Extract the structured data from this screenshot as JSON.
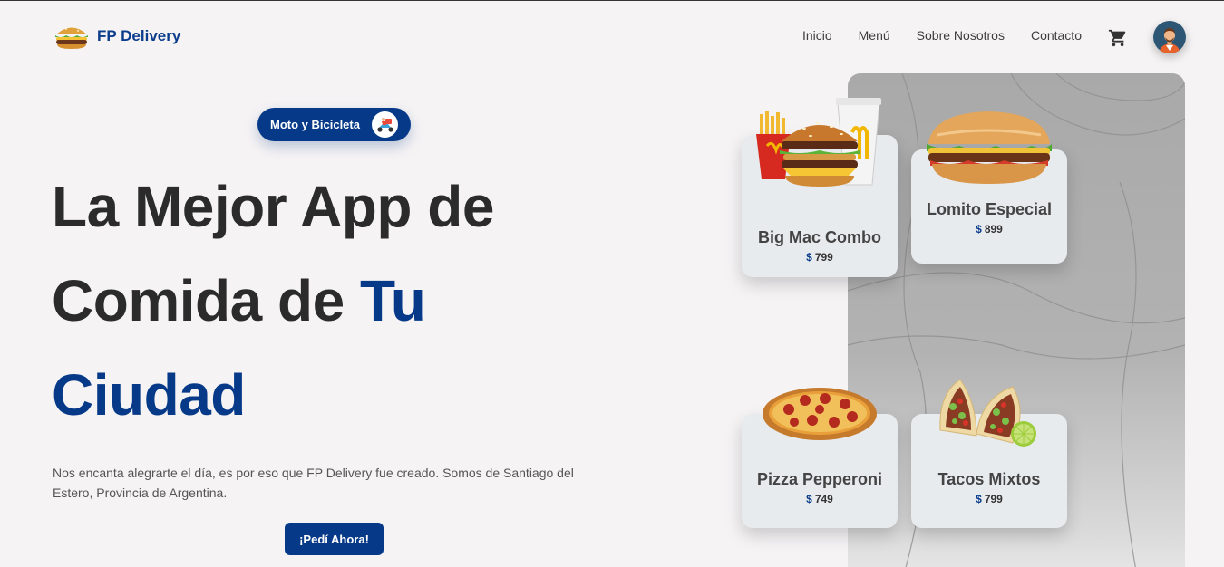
{
  "brand": {
    "name": "FP Delivery",
    "logo_icon": "burger-icon"
  },
  "nav": {
    "items": [
      {
        "label": "Inicio"
      },
      {
        "label": "Menú"
      },
      {
        "label": "Sobre Nosotros"
      },
      {
        "label": "Contacto"
      }
    ],
    "cart_icon": "cart-icon",
    "avatar_icon": "user-avatar"
  },
  "hero": {
    "pill_label": "Moto y Bicicleta",
    "pill_icon": "delivery-scooter-icon",
    "title_part1": "La Mejor App de Comida de ",
    "title_accent1": "Tu",
    "title_accent2": "Ciudad",
    "description": "Nos encanta alegrarte el día, es por eso que FP Delivery fue creado. Somos de Santiago del Estero, Provincia de Argentina.",
    "cta_label": "¡Pedí Ahora!",
    "accent_color": "#063a88"
  },
  "menu_cards": [
    {
      "name": "Big Mac Combo",
      "currency": "$",
      "price": "799",
      "image": "burger-combo-image"
    },
    {
      "name": "Lomito Especial",
      "currency": "$",
      "price": "899",
      "image": "sandwich-image"
    },
    {
      "name": "Pizza Pepperoni",
      "currency": "$",
      "price": "749",
      "image": "pizza-image"
    },
    {
      "name": "Tacos Mixtos",
      "currency": "$",
      "price": "799",
      "image": "tacos-image"
    }
  ]
}
